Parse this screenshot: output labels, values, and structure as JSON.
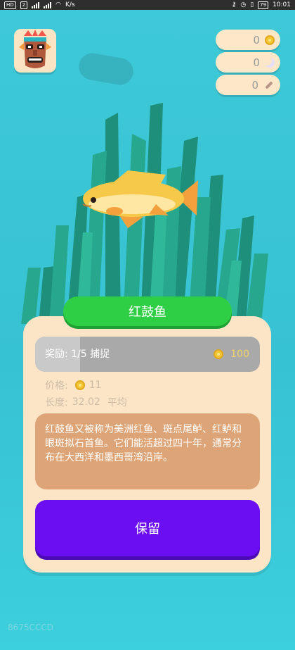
{
  "status_bar": {
    "left_badges": [
      "HD",
      "2"
    ],
    "speed": "K/s",
    "battery": "79",
    "time": "10:01"
  },
  "avatar": {
    "icon": "tiki-mask-icon"
  },
  "currencies": [
    {
      "value": "0",
      "icon": "coin-icon",
      "color": "#f3c531"
    },
    {
      "value": "0",
      "icon": "moon-icon",
      "color": "#e7dff7"
    },
    {
      "value": "0",
      "icon": "bone-icon",
      "color": "#b79687"
    }
  ],
  "fish": {
    "name": "红鼓鱼",
    "icon": "fish-icon",
    "body_color": "#f6c94a"
  },
  "reward": {
    "label": "奖励:  1/5  捕捉",
    "progress": 0.2,
    "amount": "100"
  },
  "stats": {
    "price_label": "价格:",
    "price_value": "11",
    "length_label": "长度:",
    "length_value": "32.02",
    "length_rating": "平均"
  },
  "description": "红鼓鱼又被称为美洲红鱼、斑点尾鲈、红鲈和眼斑拟石首鱼。它们能活超过四十年，通常分布在大西洋和墨西哥湾沿岸。",
  "actions": {
    "keep_label": "保留"
  },
  "watermark": "8675CCCD",
  "colors": {
    "background": "#3ec9d8",
    "title_bar": "#2fcf45",
    "card": "#fce4c6",
    "description_box": "#dda577",
    "keep_button": "#6c0ef2"
  }
}
